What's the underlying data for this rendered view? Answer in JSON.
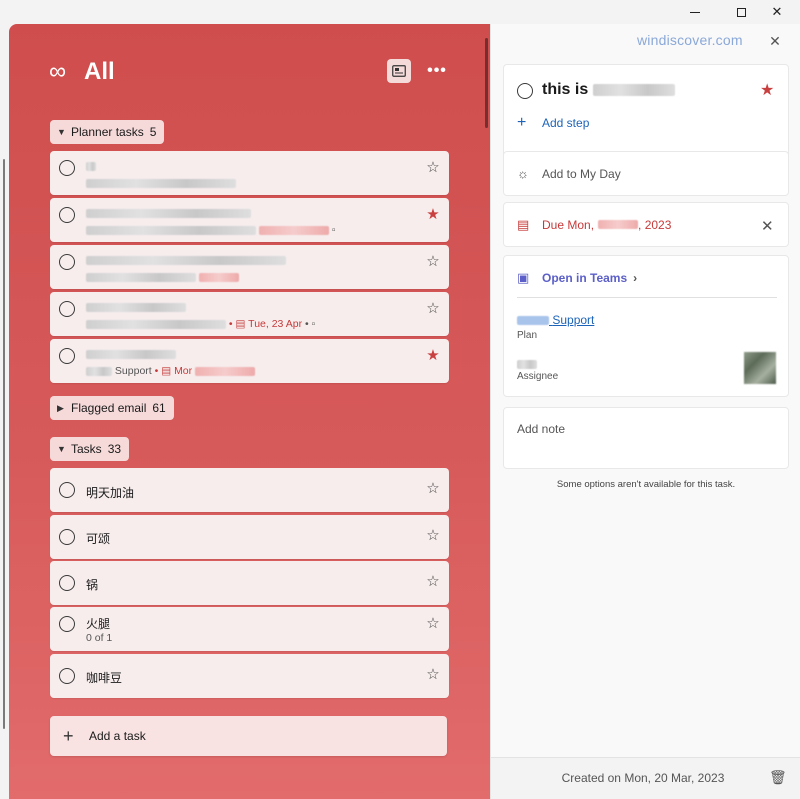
{
  "window": {
    "minimize": "—",
    "maximize": "□",
    "close": "✕"
  },
  "list": {
    "icon": "infinity-icon",
    "title": "All",
    "more": "•••",
    "groups": {
      "planner": {
        "label": "Planner tasks",
        "count": "5"
      },
      "flagged": {
        "label": "Flagged email",
        "count": "61"
      },
      "tasks": {
        "label": "Tasks",
        "count": "33"
      }
    },
    "planner_tasks": [
      {
        "title": "",
        "meta": "",
        "starred": false
      },
      {
        "title": "",
        "meta": "",
        "starred": true
      },
      {
        "title": "",
        "meta": "",
        "starred": false
      },
      {
        "title": "",
        "meta_due": "Tue, 23 Apr",
        "starred": false
      },
      {
        "title": "",
        "meta_plan": "Support",
        "meta_due": "Mor",
        "starred": true
      }
    ],
    "tasks": [
      {
        "title": "明天加油",
        "starred": false
      },
      {
        "title": "可颂",
        "starred": false
      },
      {
        "title": "锅",
        "starred": false
      },
      {
        "title": "火腿",
        "sub": "0 of 1",
        "starred": false
      },
      {
        "title": "咖啡豆",
        "starred": false
      }
    ],
    "add_task": "Add a task"
  },
  "detail": {
    "watermark": "windiscover.com",
    "close": "✕",
    "task_title": "this is",
    "add_step": "Add step",
    "add_to_my_day": "Add to My Day",
    "due": "Due Mon,",
    "due_year": ", 2023",
    "open_in_teams": "Open in Teams",
    "plan_name": "Support",
    "plan_label": "Plan",
    "assignee_label": "Assignee",
    "add_note": "Add note",
    "info": "Some options aren't available for this task.",
    "created": "Created on Mon, 20 Mar, 2023"
  },
  "colors": {
    "accent": "#cf4d4d",
    "star": "#c94040",
    "link": "#1d64b8",
    "teams": "#5b5fc7"
  }
}
